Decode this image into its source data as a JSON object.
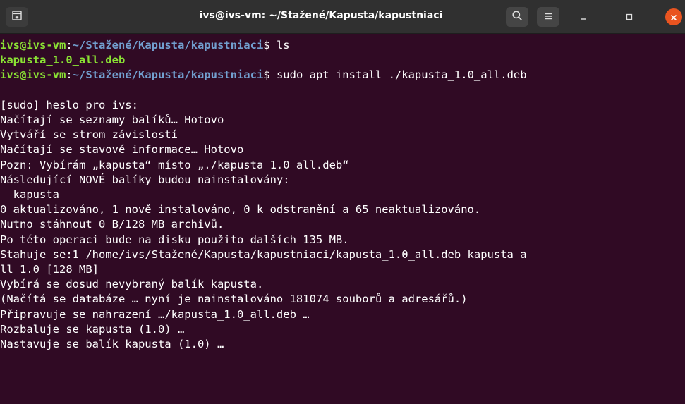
{
  "window": {
    "title": "ivs@ivs-vm: ~/Stažené/Kapusta/kapustniaci",
    "icons": [
      "new-tab-icon",
      "search-icon",
      "hamburger-menu-icon",
      "minimize-icon",
      "maximize-icon",
      "close-icon"
    ],
    "colors": {
      "titlebar": "#303030",
      "terminal_bg": "#300a24",
      "prompt_user": "#8ae234",
      "prompt_path": "#729fcf",
      "close_button": "#e95420"
    }
  },
  "terminal": {
    "prompt1": {
      "user": "ivs@ivs-vm",
      "colon": ":",
      "path": "~/Stažené/Kapusta/kapustniaci",
      "symbol": "$ ",
      "command": "ls"
    },
    "ls_output": "kapusta_1.0_all.deb",
    "prompt2": {
      "user": "ivs@ivs-vm",
      "colon": ":",
      "path": "~/Stažené/Kapusta/kapustniaci",
      "symbol": "$ ",
      "command": "sudo apt install ./kapusta_1.0_all.deb"
    },
    "output": [
      "[sudo] heslo pro ivs:",
      "Načítají se seznamy balíků… Hotovo",
      "Vytváří se strom závislostí",
      "Načítají se stavové informace… Hotovo",
      "Pozn: Vybírám „kapusta“ místo „./kapusta_1.0_all.deb“",
      "Následující NOVÉ balíky budou nainstalovány:",
      "  kapusta",
      "0 aktualizováno, 1 nově instalováno, 0 k odstranění a 65 neaktualizováno.",
      "Nutno stáhnout 0 B/128 MB archivů.",
      "Po této operaci bude na disku použito dalších 135 MB.",
      "Stahuje se:1 /home/ivs/Stažené/Kapusta/kapustniaci/kapusta_1.0_all.deb kapusta a",
      "ll 1.0 [128 MB]",
      "Vybírá se dosud nevybraný balík kapusta.",
      "(Načítá se databáze … nyní je nainstalováno 181074 souborů a adresářů.)",
      "Připravuje se nahrazení …/kapusta_1.0_all.deb …",
      "Rozbaluje se kapusta (1.0) …",
      "Nastavuje se balík kapusta (1.0) …"
    ]
  }
}
